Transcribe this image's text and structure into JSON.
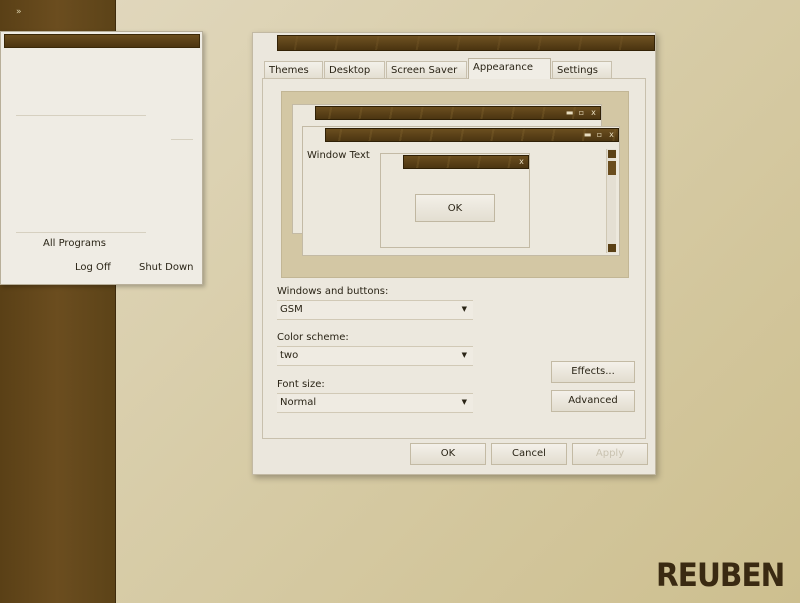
{
  "taskbar": {
    "chevron": "»"
  },
  "start_menu": {
    "all_programs": "All Programs",
    "log_off": "Log Off",
    "shut_down": "Shut Down"
  },
  "dialog": {
    "tabs": [
      {
        "label": "Themes"
      },
      {
        "label": "Desktop"
      },
      {
        "label": "Screen Saver"
      },
      {
        "label": "Appearance",
        "active": true
      },
      {
        "label": "Settings"
      }
    ],
    "preview": {
      "window_text": "Window Text",
      "ok_label": "OK",
      "close_glyph": "x"
    },
    "windows_and_buttons": {
      "label": "Windows and buttons:",
      "value": "GSM"
    },
    "color_scheme": {
      "label": "Color scheme:",
      "value": "two"
    },
    "font_size": {
      "label": "Font size:",
      "value": "Normal"
    },
    "effects_label": "Effects...",
    "advanced_label": "Advanced",
    "ok_label": "OK",
    "cancel_label": "Cancel",
    "apply_label": "Apply"
  },
  "wallpaper": {
    "logo_text": "REUBEN"
  },
  "colors": {
    "taskbar": "#5f4419",
    "titlebar": "#5a3f15",
    "window_bg": "#ebe7dd",
    "desktop": "#d8cda9",
    "logo": "#3a2a12"
  }
}
